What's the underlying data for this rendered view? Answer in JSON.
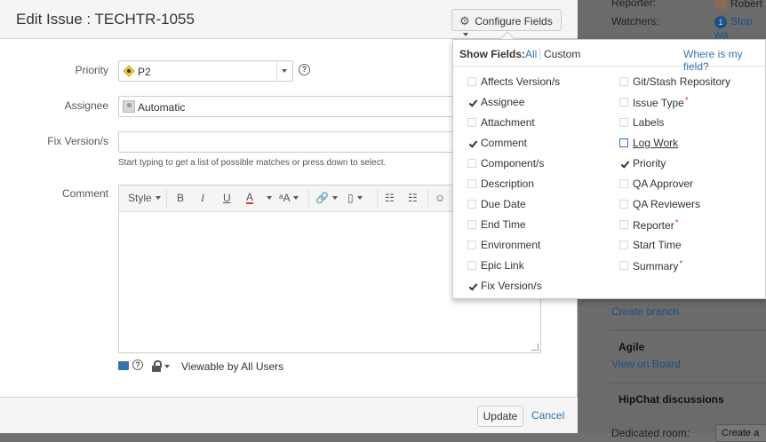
{
  "dialog": {
    "title": "Edit Issue : TECHTR-1055",
    "configure_button": "Configure Fields"
  },
  "form": {
    "priority_label": "Priority",
    "priority_value": "P2",
    "assignee_label": "Assignee",
    "assignee_value": "Automatic",
    "fixversion_label": "Fix Version/s",
    "fixversion_hint": "Start typing to get a list of possible matches or press down to select.",
    "comment_label": "Comment",
    "toolbar": {
      "style": "Style",
      "bold": "B",
      "italic": "I",
      "underline": "U",
      "color": "A",
      "size": "ᵃA",
      "link": "🔗",
      "attach": "▯",
      "bullets": "☷",
      "numbers": "☷",
      "emoji": "☺"
    },
    "visibility": "Viewable by All Users"
  },
  "footer": {
    "update": "Update",
    "cancel": "Cancel"
  },
  "popup": {
    "show_fields": "Show Fields:",
    "all": "All",
    "custom": "Custom",
    "where": "Where is my field?",
    "left_fields": [
      {
        "label": "Affects Version/s",
        "checked": false
      },
      {
        "label": "Assignee",
        "checked": true
      },
      {
        "label": "Attachment",
        "checked": false
      },
      {
        "label": "Comment",
        "checked": true
      },
      {
        "label": "Component/s",
        "checked": false
      },
      {
        "label": "Description",
        "checked": false
      },
      {
        "label": "Due Date",
        "checked": false
      },
      {
        "label": "End Time",
        "checked": false
      },
      {
        "label": "Environment",
        "checked": false
      },
      {
        "label": "Epic Link",
        "checked": false
      },
      {
        "label": "Fix Version/s",
        "checked": true
      }
    ],
    "right_fields": [
      {
        "label": "Git/Stash Repository",
        "checked": false
      },
      {
        "label": "Issue Type",
        "checked": false,
        "required": true
      },
      {
        "label": "Labels",
        "checked": false
      },
      {
        "label": "Log Work",
        "checked": false,
        "focused": true
      },
      {
        "label": "Priority",
        "checked": true
      },
      {
        "label": "QA Approver",
        "checked": false
      },
      {
        "label": "QA Reviewers",
        "checked": false
      },
      {
        "label": "Reporter",
        "checked": false,
        "required": true
      },
      {
        "label": "Start Time",
        "checked": false
      },
      {
        "label": "Summary",
        "checked": false,
        "required": true
      }
    ],
    "required_mark": "*"
  },
  "background": {
    "reporter_label": "Reporter:",
    "reporter_value": "Robert",
    "watchers_label": "Watchers:",
    "watchers_count": "1",
    "watchers_link": "Stop wa",
    "create_branch": "Create branch",
    "agile_heading": "Agile",
    "view_on_board": "View on Board",
    "hipchat_heading": "HipChat discussions",
    "dedicated_room": "Dedicated room:",
    "create_button": "Create a"
  }
}
